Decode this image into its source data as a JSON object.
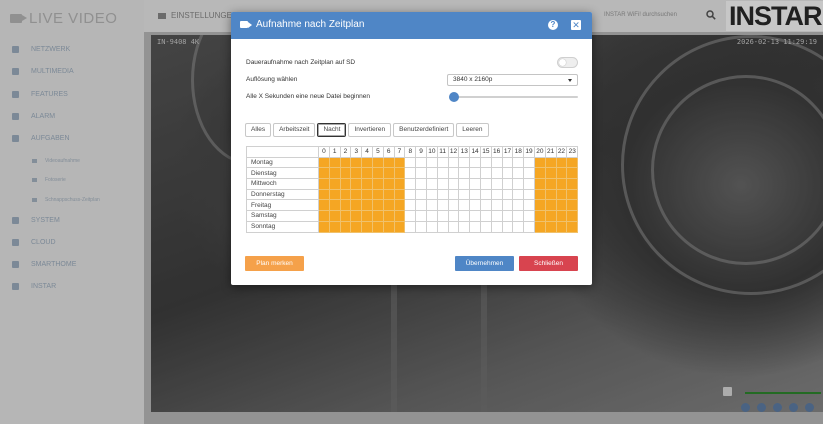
{
  "app": {
    "title": "LIVE VIDEO",
    "settings_label": "EINSTELLUNGEN",
    "model_label": "INSTAR WiFi! durchsuchen",
    "brand": "INSTAR"
  },
  "sidebar": {
    "items": [
      {
        "label": "NETZWERK",
        "icon": "network-icon"
      },
      {
        "label": "MULTIMEDIA",
        "icon": "multimedia-icon"
      },
      {
        "label": "FEATURES",
        "icon": "features-icon"
      },
      {
        "label": "ALARM",
        "icon": "alarm-icon"
      },
      {
        "label": "AUFGABEN",
        "icon": "tasks-icon"
      },
      {
        "label": "SYSTEM",
        "icon": "system-icon"
      },
      {
        "label": "CLOUD",
        "icon": "cloud-icon"
      },
      {
        "label": "SMARTHOME",
        "icon": "smarthome-icon"
      },
      {
        "label": "INSTAR",
        "icon": "instar-icon"
      }
    ],
    "subitems": [
      {
        "label": "Videoaufnahme"
      },
      {
        "label": "Fotoserie"
      },
      {
        "label": "Schnappschuss-Zeitplan"
      }
    ]
  },
  "video": {
    "timestamp_left": "IN-9408 4K",
    "timestamp_right": "2026-02-13 11:29:19"
  },
  "modal": {
    "title": "Aufnahme nach Zeitplan",
    "help_glyph": "?",
    "close_glyph": "✕",
    "continuous_label": "Daueraufnahme nach Zeitplan auf SD",
    "continuous_enabled": false,
    "resolution_label": "Auflösung wählen",
    "resolution_value": "3840 x 2160p",
    "interval_label": "Alle X Sekunden eine neue Datei beginnen",
    "interval_slider_fraction": 0,
    "presets": [
      "Alles",
      "Arbeitszeit",
      "Nacht",
      "Invertieren",
      "Benutzerdefiniert",
      "Leeren"
    ],
    "active_preset": "Nacht",
    "hours": [
      "0",
      "1",
      "2",
      "3",
      "4",
      "5",
      "6",
      "7",
      "8",
      "9",
      "10",
      "11",
      "12",
      "13",
      "14",
      "15",
      "16",
      "17",
      "18",
      "19",
      "20",
      "21",
      "22",
      "23"
    ],
    "days": [
      "Montag",
      "Dienstag",
      "Mittwoch",
      "Donnerstag",
      "Freitag",
      "Samstag",
      "Sonntag"
    ],
    "active_hours": [
      0,
      1,
      2,
      3,
      4,
      5,
      6,
      7,
      20,
      21,
      22,
      23
    ],
    "active_color": "#f5a623",
    "buttons": {
      "remember": "Plan merken",
      "apply": "Übernehmen",
      "close": "Schließen"
    }
  }
}
